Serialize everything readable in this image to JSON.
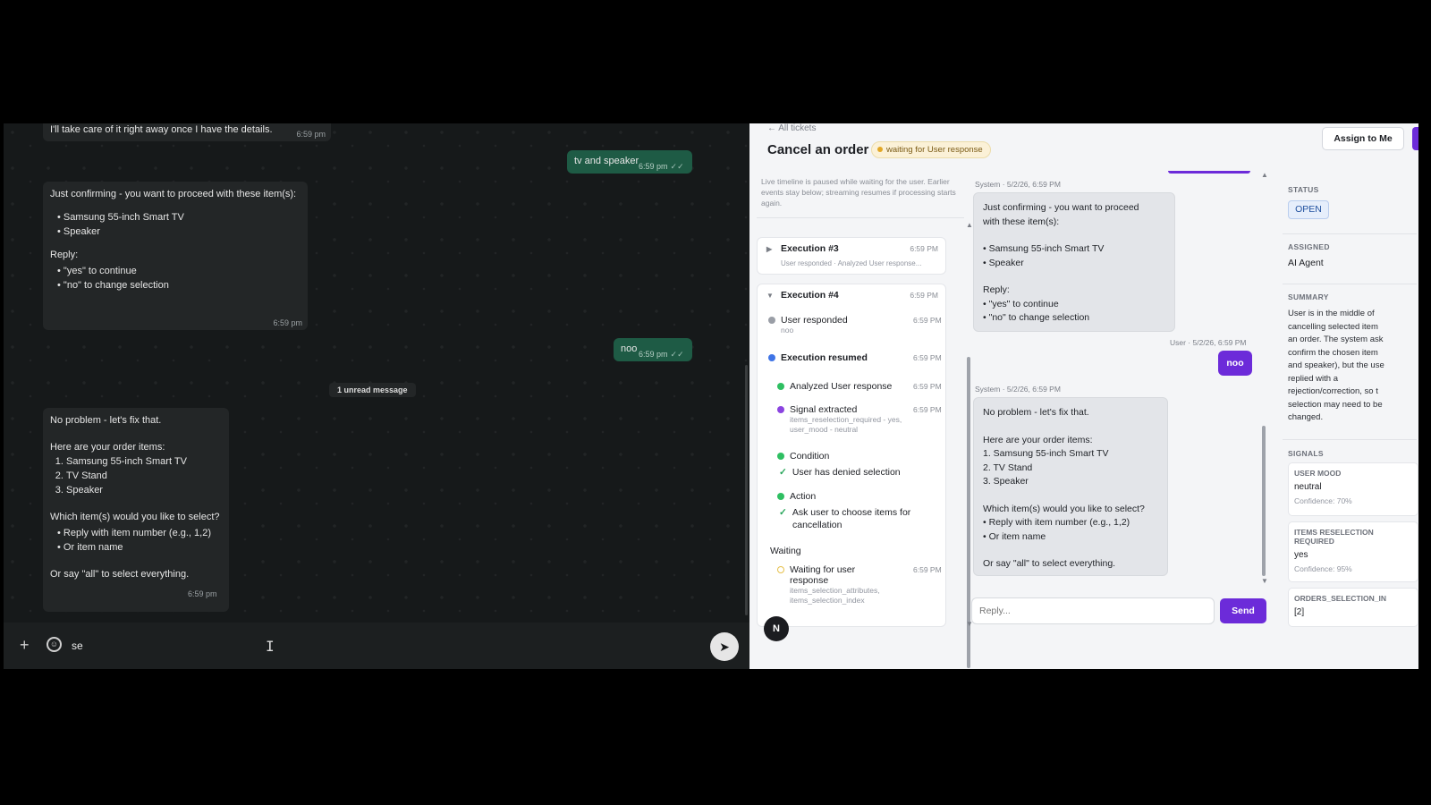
{
  "whatsapp": {
    "messages": {
      "m1_text": "I'll take care of it right away once I have the details.",
      "m1_time": "6:59 pm",
      "m2_text": "tv and speaker",
      "m2_time": "6:59 pm",
      "m3_intro": "Just confirming - you want to proceed with these item(s):",
      "m3_items": [
        "Samsung 55-inch Smart TV",
        "Speaker"
      ],
      "m3_reply_label": "Reply:",
      "m3_reply_options": [
        "\"yes\" to continue",
        "\"no\" to change selection"
      ],
      "m3_time": "6:59 pm",
      "m4_text": "noo",
      "m4_time": "6:59 pm",
      "unread": "1 unread message",
      "m5_intro": "No problem - let's fix that.",
      "m5_items_label": "Here are your order items:",
      "m5_items": [
        "Samsung 55-inch Smart TV",
        "TV Stand",
        "Speaker"
      ],
      "m5_question": "Which item(s) would you like to select?",
      "m5_options": [
        "Reply with item number (e.g., 1,2)",
        "Or item name"
      ],
      "m5_all": "Or say \"all\" to select everything.",
      "m5_time": "6:59 pm"
    },
    "compose_value": "se"
  },
  "ticket": {
    "back_link": "← All tickets",
    "title": "Cancel an order",
    "status_badge": "waiting for User response",
    "assign_button": "Assign to Me",
    "timeline": {
      "note": "Live timeline is paused while waiting for the user. Earlier events stay below; streaming resumes if processing starts again.",
      "exec3": {
        "title": "Execution #3",
        "time": "6:59 PM",
        "sub": "User responded · Analyzed User response..."
      },
      "exec4": {
        "title": "Execution #4",
        "time": "6:59 PM"
      },
      "events": {
        "user_responded": {
          "label": "User responded",
          "time": "6:59 PM",
          "sub": "noo"
        },
        "exec_resumed": {
          "label": "Execution resumed",
          "time": "6:59 PM"
        },
        "analyzed": {
          "label": "Analyzed User response",
          "time": "6:59 PM"
        },
        "signal": {
          "label": "Signal extracted",
          "time": "6:59 PM",
          "sub1": "items_reselection_required - yes,",
          "sub2": "user_mood - neutral"
        },
        "condition": {
          "label": "Condition",
          "check": "User has denied selection"
        },
        "action": {
          "label": "Action",
          "check1": "Ask user to choose items for",
          "check2": "cancellation"
        },
        "waiting_header": "Waiting",
        "waiting": {
          "label1": "Waiting for user",
          "label2": "response",
          "time": "6:59 PM",
          "sub1": "items_selection_attributes,",
          "sub2": "items_selection_index"
        }
      }
    },
    "conversation": {
      "sys1_meta": "System · 5/2/26, 6:59 PM",
      "sys1": {
        "line1": "Just confirming - you want to proceed",
        "line2": "with these item(s):",
        "items": [
          "• Samsung 55-inch Smart TV",
          "• Speaker"
        ],
        "reply": "Reply:",
        "opts": [
          "• \"yes\" to continue",
          "• \"no\" to change selection"
        ]
      },
      "user_meta": "User · 5/2/26, 6:59 PM",
      "user_msg": "noo",
      "sys2_meta": "System · 5/2/26, 6:59 PM",
      "sys2": {
        "intro": "No problem - let's fix that.",
        "items_label": "Here are your order items:",
        "items": [
          "1. Samsung 55-inch Smart TV",
          "2. TV Stand",
          "3. Speaker"
        ],
        "question": "Which item(s) would you like to select?",
        "opts": [
          "• Reply with item number (e.g., 1,2)",
          "• Or item name"
        ],
        "all": "Or say \"all\" to select everything."
      },
      "reply_placeholder": "Reply...",
      "send_label": "Send",
      "avatar_letter": "N"
    },
    "sidebar": {
      "status_h": "STATUS",
      "status_v": "OPEN",
      "assigned_h": "ASSIGNED",
      "assigned_v": "AI Agent",
      "summary_h": "SUMMARY",
      "summary_lines": [
        "User is in the middle of",
        "cancelling selected item",
        "an order. The system ask",
        "confirm the chosen item",
        "and speaker), but the use",
        "replied with a",
        "rejection/correction, so t",
        "selection may need to be",
        "changed."
      ],
      "signals_h": "SIGNALS",
      "sig1": {
        "k": "USER MOOD",
        "v": "neutral",
        "c": "Confidence: 70%"
      },
      "sig2": {
        "k1": "ITEMS RESELECTION",
        "k2": "REQUIRED",
        "v": "yes",
        "c": "Confidence: 95%"
      },
      "sig3": {
        "k": "ORDERS_SELECTION_IN",
        "v": "[2]"
      }
    }
  }
}
